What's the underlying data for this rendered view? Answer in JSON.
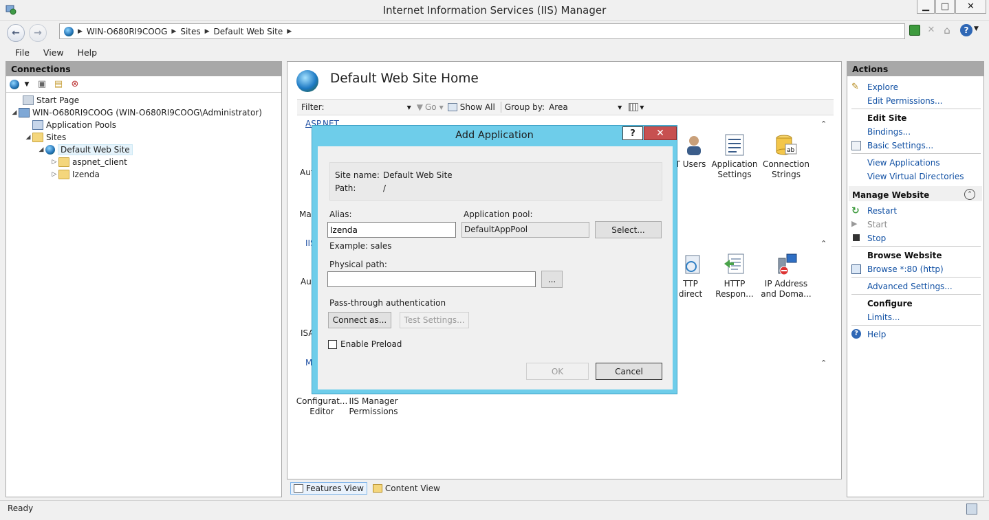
{
  "window": {
    "title": "Internet Information Services (IIS) Manager",
    "min": "▁",
    "max": "□",
    "close": "✕"
  },
  "address": {
    "crumbs": [
      "WIN-O680RI9COOG",
      "Sites",
      "Default Web Site"
    ]
  },
  "menu": [
    "File",
    "View",
    "Help"
  ],
  "connections": {
    "title": "Connections",
    "tree": [
      {
        "label": "Start Page"
      },
      {
        "label": "WIN-O680RI9COOG (WIN-O680RI9COOG\\Administrator)"
      },
      {
        "label": "Application Pools"
      },
      {
        "label": "Sites"
      },
      {
        "label": "Default Web Site"
      },
      {
        "label": "aspnet_client"
      },
      {
        "label": "Izenda"
      }
    ]
  },
  "main": {
    "title": "Default Web Site Home",
    "filter_label": "Filter:",
    "go_label": "Go",
    "show_all": "Show All",
    "group_by_label": "Group by:",
    "group_by_value": "Area",
    "section_aspnet": "ASP.NET",
    "partial": {
      "au1": "Aut",
      "ma": "Mac",
      "iis": "IIS",
      "au2": "Aut",
      "isa": "ISA",
      "m": "M"
    },
    "features": [
      {
        "line1": "T Users",
        "line2": ""
      },
      {
        "line1": "Application",
        "line2": "Settings"
      },
      {
        "line1": "Connection",
        "line2": "Strings"
      },
      {
        "line1": "TTP",
        "line2": "direct"
      },
      {
        "line1": "HTTP",
        "line2": "Respon..."
      },
      {
        "line1": "IP Address",
        "line2": "and Doma..."
      },
      {
        "line1": "Configurat...",
        "line2": "Editor"
      },
      {
        "line1": "IIS Manager",
        "line2": "Permissions"
      }
    ],
    "tabs": [
      "Features View",
      "Content View"
    ]
  },
  "actions": {
    "title": "Actions",
    "explore": "Explore",
    "edit_permissions": "Edit Permissions...",
    "edit_site": "Edit Site",
    "bindings": "Bindings...",
    "basic_settings": "Basic Settings...",
    "view_applications": "View Applications",
    "view_virtual_directories": "View Virtual Directories",
    "manage_website": "Manage Website",
    "restart": "Restart",
    "start": "Start",
    "stop": "Stop",
    "browse_website": "Browse Website",
    "browse_80": "Browse *:80 (http)",
    "advanced_settings": "Advanced Settings...",
    "configure": "Configure",
    "limits": "Limits...",
    "help": "Help"
  },
  "status": {
    "text": "Ready"
  },
  "dialog": {
    "title": "Add Application",
    "help": "?",
    "close": "✕",
    "site_name_label": "Site name:",
    "site_name_value": "Default Web Site",
    "path_label": "Path:",
    "path_value": "/",
    "alias_label": "Alias:",
    "alias_value": "Izenda",
    "example": "Example: sales",
    "app_pool_label": "Application pool:",
    "app_pool_value": "DefaultAppPool",
    "select_button": "Select...",
    "physical_path_label": "Physical path:",
    "physical_path_value": "",
    "browse_button": "...",
    "passthrough_label": "Pass-through authentication",
    "connect_as_button": "Connect as...",
    "test_settings_button": "Test Settings...",
    "enable_preload": "Enable Preload",
    "ok_button": "OK",
    "cancel_button": "Cancel"
  }
}
